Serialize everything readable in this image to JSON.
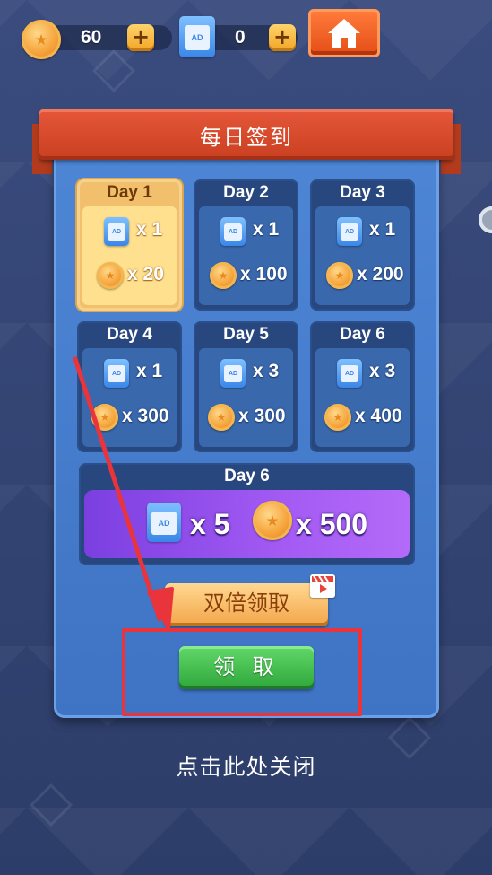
{
  "topbar": {
    "coins": "60",
    "ad_tickets": "0",
    "plus_label": "+"
  },
  "dialog": {
    "title": "每日签到",
    "days": [
      {
        "label": "Day 1",
        "ad_qty": "x 1",
        "coin_qty": "x 20",
        "state": "active"
      },
      {
        "label": "Day 2",
        "ad_qty": "x 1",
        "coin_qty": "x 100",
        "state": "normal"
      },
      {
        "label": "Day 3",
        "ad_qty": "x 1",
        "coin_qty": "x 200",
        "state": "normal"
      },
      {
        "label": "Day 4",
        "ad_qty": "x 1",
        "coin_qty": "x 300",
        "state": "normal"
      },
      {
        "label": "Day 5",
        "ad_qty": "x 3",
        "coin_qty": "x 300",
        "state": "normal"
      },
      {
        "label": "Day 6",
        "ad_qty": "x 3",
        "coin_qty": "x 400",
        "state": "normal"
      }
    ],
    "big_day": {
      "label": "Day 6",
      "ad_qty": "x 5",
      "coin_qty": "x 500"
    },
    "double_claim_label": "双倍领取",
    "claim_label": "领 取",
    "ad_icon_text": "AD"
  },
  "close_hint": "点击此处关闭",
  "colors": {
    "ribbon": "#d84a2a",
    "panel": "#4a7fd0",
    "claim_green": "#3cb846",
    "highlight_red": "#e8343a",
    "annotation_arrow": "#e8343a"
  }
}
